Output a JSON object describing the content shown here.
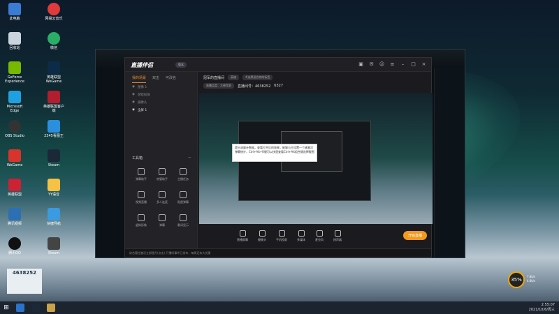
{
  "desktop": {
    "icons_col1": [
      "此电脑",
      "回收站",
      "GeForce Experience",
      "Microsoft Edge",
      "OBS Studio",
      "WeGame",
      "英雄联盟",
      "腾讯视频",
      "腾讯QQ",
      "网易云音乐"
    ],
    "icons_col2": [
      "网易云音乐",
      "微信",
      "英雄联盟 WeGame",
      "英雄联盟客户端",
      "2345看图王",
      "Steam",
      "YY语音",
      "快捷导航",
      "Steam",
      "Wallpaper"
    ],
    "id_box": "4638252"
  },
  "app": {
    "logo": "直播伴侣",
    "badge": "版本",
    "tabs": [
      "我的场景",
      "双击",
      "可改名"
    ],
    "scenes": [
      "图像 1",
      "游戏投屏",
      "摄像头",
      "全屏 1"
    ],
    "tools_title": "工具箱",
    "tools": [
      "弹幕助手",
      "房管助手",
      "主播任务",
      "视频直播",
      "多人连麦",
      "贴图弹幕",
      "虚拟形象",
      "弹幕",
      "歌词显示",
      "更多",
      "",
      ""
    ],
    "room_name": "冠军的直播间",
    "room_tags": [
      "英雄",
      "#选择适合你的标签"
    ],
    "room_meta": [
      "直播品类：大神驾到",
      "直播间号：4638252",
      "6327"
    ],
    "controls": [
      "直播屏幕",
      "摄像头",
      "手机投屏",
      "多媒体",
      "麦克风",
      "扬声器"
    ],
    "live_button": "开始直播",
    "status_text": "综合管控激活立即提升(点击)  开播时事件已发布，每周还有大优惠",
    "tooltip": "提示流量计数据，查看打开后的效果，能够与主设置一个键激活弹幕统计，Ctrl+Alt+R键可以快速查看Ctrl+Alt组合键选择截图",
    "title_icons": [
      "gift-icon",
      "mail-icon",
      "user-icon",
      "menu-icon",
      "minimize-icon",
      "maximize-icon",
      "close-icon"
    ]
  },
  "taskbar": {
    "time": "2:55:07",
    "date": "2021/10/6/周三",
    "gauge": "35%",
    "net_up": "7.8k/s",
    "net_down": "4.8k/s"
  }
}
